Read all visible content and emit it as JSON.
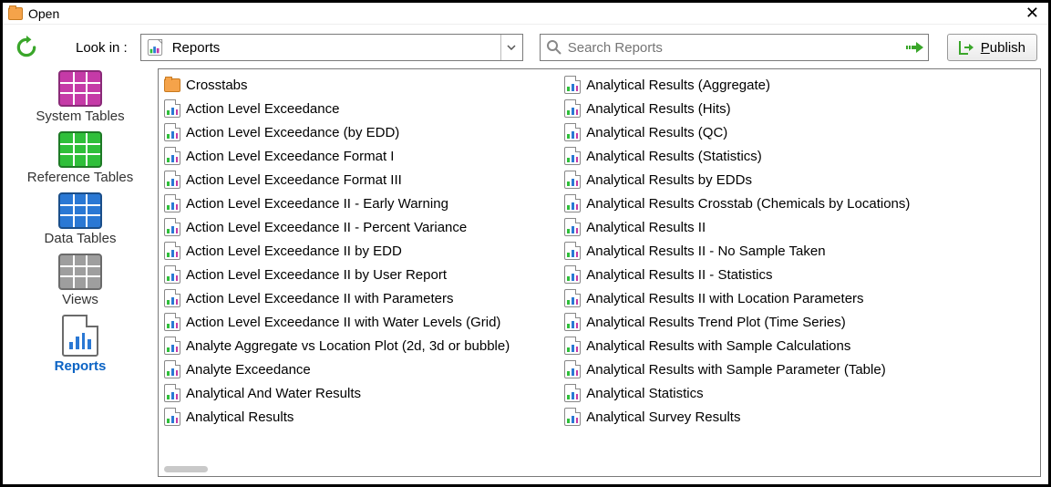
{
  "window": {
    "title": "Open"
  },
  "toolbar": {
    "look_in_label": "Look in :",
    "combo_value": "Reports",
    "search_placeholder": "Search Reports",
    "publish_label": "Publish"
  },
  "sidebar": {
    "items": [
      {
        "id": "system-tables",
        "label": "System Tables",
        "color": "magenta",
        "active": false
      },
      {
        "id": "reference-tables",
        "label": "Reference Tables",
        "color": "green",
        "active": false
      },
      {
        "id": "data-tables",
        "label": "Data Tables",
        "color": "blue",
        "active": false
      },
      {
        "id": "views",
        "label": "Views",
        "color": "gray",
        "active": false
      },
      {
        "id": "reports",
        "label": "Reports",
        "color": "report",
        "active": true
      }
    ]
  },
  "files": {
    "col1": [
      {
        "type": "folder",
        "name": "Crosstabs"
      },
      {
        "type": "report",
        "name": "Action Level Exceedance"
      },
      {
        "type": "report",
        "name": "Action Level Exceedance (by EDD)"
      },
      {
        "type": "report",
        "name": "Action Level Exceedance Format I"
      },
      {
        "type": "report",
        "name": "Action Level Exceedance Format III"
      },
      {
        "type": "report",
        "name": "Action Level Exceedance II - Early Warning"
      },
      {
        "type": "report",
        "name": "Action Level Exceedance II - Percent Variance"
      },
      {
        "type": "report",
        "name": "Action Level Exceedance II by EDD"
      },
      {
        "type": "report",
        "name": "Action Level Exceedance II by User Report"
      },
      {
        "type": "report",
        "name": "Action Level Exceedance II with Parameters"
      },
      {
        "type": "report",
        "name": "Action Level Exceedance II with Water Levels (Grid)"
      },
      {
        "type": "report",
        "name": "Analyte Aggregate vs Location Plot (2d, 3d or bubble)"
      },
      {
        "type": "report",
        "name": "Analyte Exceedance"
      },
      {
        "type": "report",
        "name": "Analytical And Water Results"
      },
      {
        "type": "report",
        "name": "Analytical Results"
      }
    ],
    "col2": [
      {
        "type": "report",
        "name": "Analytical Results (Aggregate)"
      },
      {
        "type": "report",
        "name": "Analytical Results (Hits)"
      },
      {
        "type": "report",
        "name": "Analytical Results (QC)"
      },
      {
        "type": "report",
        "name": "Analytical Results (Statistics)"
      },
      {
        "type": "report",
        "name": "Analytical Results by EDDs"
      },
      {
        "type": "report",
        "name": "Analytical Results Crosstab (Chemicals by Locations)"
      },
      {
        "type": "report",
        "name": "Analytical Results II"
      },
      {
        "type": "report",
        "name": "Analytical Results II - No Sample Taken"
      },
      {
        "type": "report",
        "name": "Analytical Results II - Statistics"
      },
      {
        "type": "report",
        "name": "Analytical Results II with Location Parameters"
      },
      {
        "type": "report",
        "name": "Analytical Results Trend Plot (Time Series)"
      },
      {
        "type": "report",
        "name": "Analytical Results with Sample Calculations"
      },
      {
        "type": "report",
        "name": "Analytical Results with Sample Parameter (Table)"
      },
      {
        "type": "report",
        "name": "Analytical Statistics"
      },
      {
        "type": "report",
        "name": "Analytical Survey Results"
      }
    ]
  }
}
